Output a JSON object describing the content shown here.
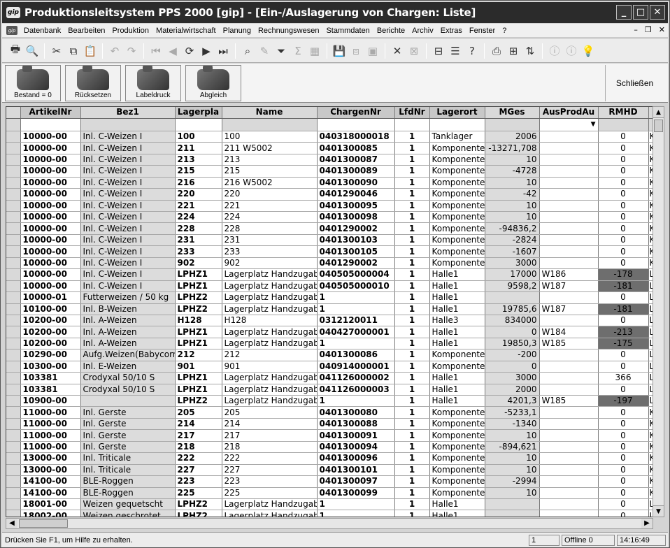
{
  "window": {
    "title": "Produktionsleitsystem PPS 2000 [gip] - [Ein-/Auslagerung von Chargen:  Liste]",
    "app_icon": "gip"
  },
  "menu": {
    "items": [
      "Datenbank",
      "Bearbeiten",
      "Produktion",
      "Materialwirtschaft",
      "Planung",
      "Rechnungswesen",
      "Stammdaten",
      "Berichte",
      "Archiv",
      "Extras",
      "Fenster",
      "?"
    ]
  },
  "buttons": [
    {
      "label": "Bestand = 0"
    },
    {
      "label": "Rücksetzen"
    },
    {
      "label": "Labeldruck"
    },
    {
      "label": "Abgleich"
    }
  ],
  "close_label": "Schließen",
  "table": {
    "headers": [
      "ArtikelNr",
      "Bez1",
      "Lagerpla",
      "Name",
      "ChargenNr",
      "LfdNr",
      "Lagerort",
      "MGes",
      "AusProdAu",
      "RMHD"
    ],
    "rows": [
      [
        "10000-00",
        "Inl. C-Weizen I",
        "100",
        "100",
        "040318000018",
        "1",
        "Tanklager",
        "2006",
        "",
        "0"
      ],
      [
        "10000-00",
        "Inl. C-Weizen I",
        "211",
        "211 W5002",
        "0401300085",
        "1",
        "Komponente",
        "-13271,708",
        "",
        "0"
      ],
      [
        "10000-00",
        "Inl. C-Weizen I",
        "213",
        "213",
        "0401300087",
        "1",
        "Komponente",
        "10",
        "",
        "0"
      ],
      [
        "10000-00",
        "Inl. C-Weizen I",
        "215",
        "215",
        "0401300089",
        "1",
        "Komponente",
        "-4728",
        "",
        "0"
      ],
      [
        "10000-00",
        "Inl. C-Weizen I",
        "216",
        "216 W5002",
        "0401300090",
        "1",
        "Komponente",
        "10",
        "",
        "0"
      ],
      [
        "10000-00",
        "Inl. C-Weizen I",
        "220",
        "220",
        "0401290046",
        "1",
        "Komponente",
        "-42",
        "",
        "0"
      ],
      [
        "10000-00",
        "Inl. C-Weizen I",
        "221",
        "221",
        "0401300095",
        "1",
        "Komponente",
        "10",
        "",
        "0"
      ],
      [
        "10000-00",
        "Inl. C-Weizen I",
        "224",
        "224",
        "0401300098",
        "1",
        "Komponente",
        "10",
        "",
        "0"
      ],
      [
        "10000-00",
        "Inl. C-Weizen I",
        "228",
        "228",
        "0401290002",
        "1",
        "Komponente",
        "-94836,2",
        "",
        "0"
      ],
      [
        "10000-00",
        "Inl. C-Weizen I",
        "231",
        "231",
        "0401300103",
        "1",
        "Komponente",
        "-2824",
        "",
        "0"
      ],
      [
        "10000-00",
        "Inl. C-Weizen I",
        "233",
        "233",
        "0401300105",
        "1",
        "Komponente",
        "-1607",
        "",
        "0"
      ],
      [
        "10000-00",
        "Inl. C-Weizen I",
        "902",
        "902",
        "0401290002",
        "1",
        "Komponente",
        "3000",
        "",
        "0"
      ],
      [
        "10000-00",
        "Inl. C-Weizen I",
        "LPHZ1",
        "Lagerplatz Handzugabe",
        "040505000004",
        "1",
        "Halle1",
        "17000",
        "W186",
        "-178"
      ],
      [
        "10000-00",
        "Inl. C-Weizen I",
        "LPHZ1",
        "Lagerplatz Handzugabe",
        "040505000010",
        "1",
        "Halle1",
        "9598,2",
        "W187",
        "-181"
      ],
      [
        "10000-01",
        "Futterweizen / 50 kg",
        "LPHZ2",
        "Lagerplatz Handzugabe",
        "1",
        "1",
        "Halle1",
        "",
        "",
        "0"
      ],
      [
        "10100-00",
        "Inl. B-Weizen",
        "LPHZ2",
        "Lagerplatz Handzugabe",
        "1",
        "1",
        "Halle1",
        "19785,6",
        "W187",
        "-181"
      ],
      [
        "10200-00",
        "Inl. A-Weizen",
        "H128",
        "H128",
        "0312120011",
        "1",
        "Halle3",
        "834000",
        "",
        "0"
      ],
      [
        "10200-00",
        "Inl. A-Weizen",
        "LPHZ1",
        "Lagerplatz Handzugabe",
        "040427000001",
        "1",
        "Halle1",
        "0",
        "W184",
        "-213"
      ],
      [
        "10200-00",
        "Inl. A-Weizen",
        "LPHZ1",
        "Lagerplatz Handzugabe",
        "1",
        "1",
        "Halle1",
        "19850,3",
        "W185",
        "-175"
      ],
      [
        "10290-00",
        "Aufg.Weizen(Babycorn",
        "212",
        "212",
        "0401300086",
        "1",
        "Komponente",
        "-200",
        "",
        "0"
      ],
      [
        "10300-00",
        "Inl. E-Weizen",
        "901",
        "901",
        "040914000001",
        "1",
        "Komponente",
        "0",
        "",
        "0"
      ],
      [
        "103381",
        "Crodyxal 50/10 S",
        "LPHZ1",
        "Lagerplatz Handzugabe",
        "041126000002",
        "1",
        "Halle1",
        "3000",
        "",
        "366"
      ],
      [
        "103381",
        "Crodyxal 50/10 S",
        "LPHZ1",
        "Lagerplatz Handzugabe",
        "041126000003",
        "1",
        "Halle1",
        "2000",
        "",
        "0"
      ],
      [
        "10900-00",
        "",
        "LPHZ2",
        "Lagerplatz Handzugabe",
        "1",
        "1",
        "Halle1",
        "4201,3",
        "W185",
        "-197"
      ],
      [
        "11000-00",
        "Inl. Gerste",
        "205",
        "205",
        "0401300080",
        "1",
        "Komponente",
        "-5233,1",
        "",
        "0"
      ],
      [
        "11000-00",
        "Inl. Gerste",
        "214",
        "214",
        "0401300088",
        "1",
        "Komponente",
        "-1340",
        "",
        "0"
      ],
      [
        "11000-00",
        "Inl. Gerste",
        "217",
        "217",
        "0401300091",
        "1",
        "Komponente",
        "10",
        "",
        "0"
      ],
      [
        "11000-00",
        "Inl. Gerste",
        "218",
        "218",
        "0401300094",
        "1",
        "Komponente",
        "-894,621",
        "",
        "0"
      ],
      [
        "13000-00",
        "Inl. Triticale",
        "222",
        "222",
        "0401300096",
        "1",
        "Komponente",
        "10",
        "",
        "0"
      ],
      [
        "13000-00",
        "Inl. Triticale",
        "227",
        "227",
        "0401300101",
        "1",
        "Komponente",
        "10",
        "",
        "0"
      ],
      [
        "14100-00",
        "BLE-Roggen",
        "223",
        "223",
        "0401300097",
        "1",
        "Komponente",
        "-2994",
        "",
        "0"
      ],
      [
        "14100-00",
        "BLE-Roggen",
        "225",
        "225",
        "0401300099",
        "1",
        "Komponente",
        "10",
        "",
        "0"
      ],
      [
        "18001-00",
        "Weizen gequetscht",
        "LPHZ2",
        "Lagerplatz Handzugabe",
        "1",
        "1",
        "Halle1",
        "",
        "",
        "0"
      ],
      [
        "18002-00",
        "Weizen geschrotet",
        "LPHZ2",
        "Lagerplatz Handzugabe",
        "1",
        "1",
        "Halle1",
        "",
        "",
        "0"
      ]
    ],
    "highlighted_rmhd": [
      "-178",
      "-181",
      "-213",
      "-175",
      "-197"
    ],
    "last_col_glyphs": [
      "K",
      "K",
      "K",
      "K",
      "K",
      "K",
      "K",
      "K",
      "K",
      "K",
      "K",
      "K",
      "L",
      "L",
      "L",
      "L",
      "L",
      "L",
      "L",
      "L",
      "L",
      "L",
      "L",
      "L",
      "K",
      "K",
      "K",
      "K",
      "K",
      "K",
      "K",
      "K",
      "L",
      "L"
    ]
  },
  "status": {
    "help_text": "Drücken Sie F1, um Hilfe zu erhalten.",
    "field1": "1",
    "offline": "Offline 0",
    "time": "14:16:49"
  },
  "colors": {
    "titlebar": "#2b2b2b",
    "highlight_cell": "#6e6e6e",
    "grey_column": "#dcdcdc"
  }
}
